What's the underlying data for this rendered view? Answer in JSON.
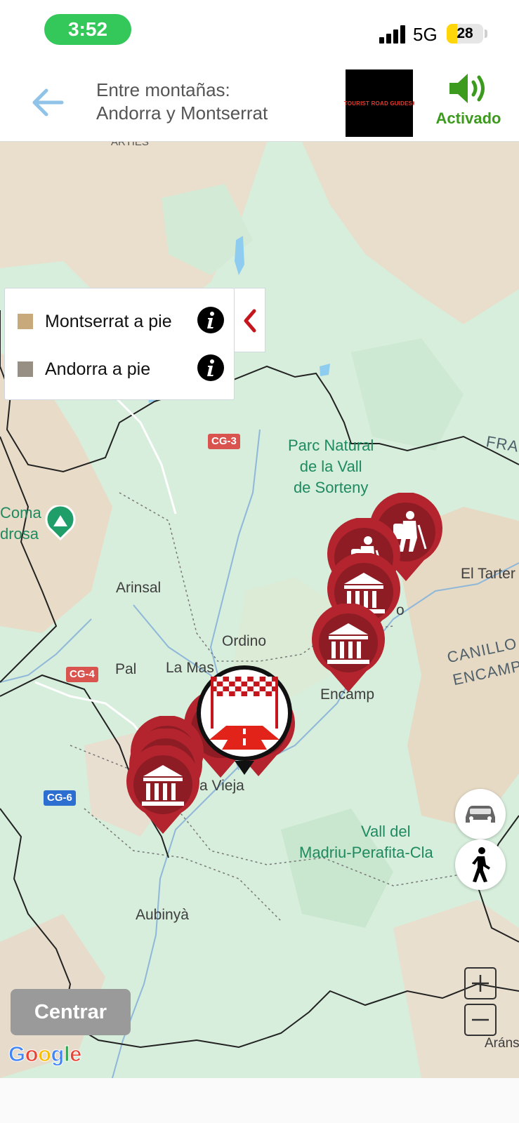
{
  "status_bar": {
    "time": "3:52",
    "network": "5G",
    "battery": "28",
    "battery_level": 0.28
  },
  "header": {
    "back_icon": "back-arrow-icon",
    "title_line1": "Entre montañas:",
    "title_line2": "Andorra y Montserrat",
    "logo_text": "TOURIST ROAD GUIDES",
    "sound_icon": "speaker-on-icon",
    "sound_label": "Activado"
  },
  "legend": {
    "items": [
      {
        "label": "Montserrat a pie",
        "color": "#c8a97c",
        "icon": "info-icon"
      },
      {
        "label": "Andorra a pie",
        "color": "#978e84",
        "icon": "info-icon"
      }
    ],
    "toggle_icon": "chevron-left-icon"
  },
  "map": {
    "places": {
      "arinsal": "Arinsal",
      "ordino": "Ordino",
      "la_massana": "La Mas",
      "pal": "Pal",
      "encamp": "Encamp",
      "el_tarter": "El Tarter",
      "aubinya": "Aubinyà",
      "la_vieja": "a Vieja",
      "coma": "Coma",
      "drosa": "drosa",
      "arans": "Aráns",
      "arties": "ARTIES",
      "canillo": "CANILLO",
      "encamp_region": "ENCAMP",
      "france": "FRA",
      "o_suffix": "o"
    },
    "parks": {
      "sorteny": "Parc Natural\nde la Vall\nde Sorteny",
      "madriu_line1": "Vall del",
      "madriu_line2": "Madriu-Perafita-Cla"
    },
    "roads": [
      "CG-3",
      "CG-4",
      "CG-6"
    ],
    "marker_colors": {
      "poi": "#b3242e",
      "poi_dark": "#8e1c24"
    }
  },
  "controls": {
    "car_icon": "car-icon",
    "walk_icon": "walking-person-icon",
    "zoom_in": "+",
    "zoom_out": "−",
    "center_label": "Centrar",
    "google_label": "Google"
  }
}
